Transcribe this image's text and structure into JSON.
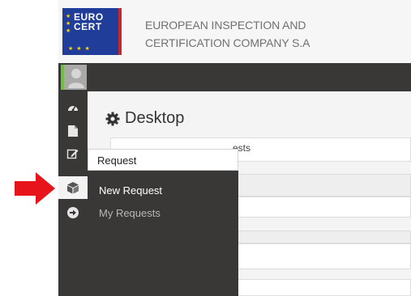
{
  "header": {
    "logo_line1": "EURO",
    "logo_line2": "CERT",
    "company_line1": "EUROPEAN INSPECTION AND",
    "company_line2": "CERTIFICATION COMPANY S.A"
  },
  "sidebar": {
    "items": [
      {
        "icon": "dashboard-icon"
      },
      {
        "icon": "document-icon"
      },
      {
        "icon": "edit-icon"
      },
      {
        "icon": "cube-icon",
        "active": true
      },
      {
        "icon": "arrow-circle-right-icon"
      }
    ]
  },
  "main": {
    "title": "Desktop",
    "partial_text": "ests"
  },
  "dropdown": {
    "header": "Request",
    "items": [
      {
        "label": "New Request",
        "active": true
      },
      {
        "label": "My Requests",
        "active": false
      }
    ]
  },
  "colors": {
    "brand_blue": "#1f3d99",
    "brand_red": "#c6262e",
    "sidebar_dark": "#3a3836",
    "callout_arrow": "#e8141c",
    "avatar_accent": "#6fbf3e"
  }
}
